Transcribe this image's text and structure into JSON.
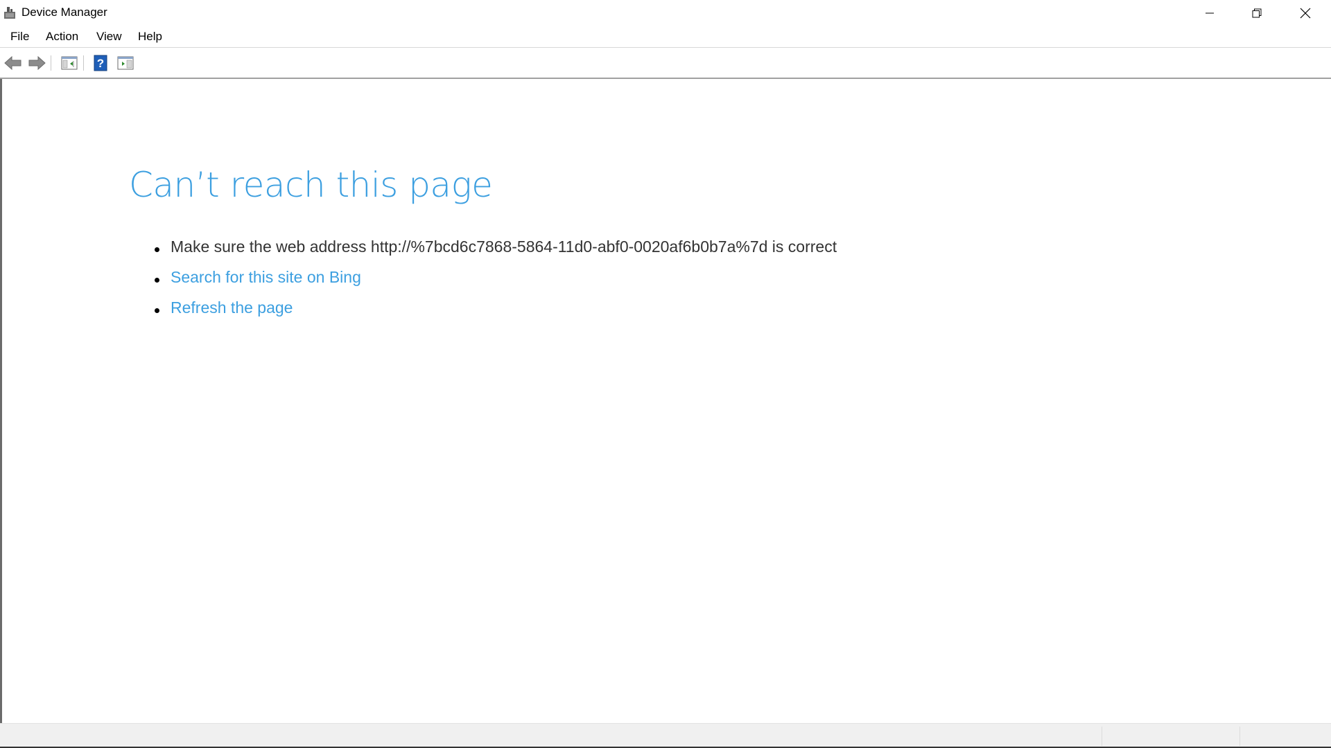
{
  "window": {
    "title": "Device Manager"
  },
  "menu": {
    "file": "File",
    "action": "Action",
    "view": "View",
    "help": "Help"
  },
  "toolbar": {
    "icons": [
      "back-arrow-icon",
      "forward-arrow-icon",
      "show-hide-console-tree-icon",
      "help-icon",
      "show-hide-action-pane-icon"
    ]
  },
  "error_page": {
    "title": "Can’t reach this page",
    "items": [
      {
        "text": "Make sure the web address http://%7bcd6c7868-5864-11d0-abf0-0020af6b0b7a%7d is correct",
        "link": false
      },
      {
        "text": "Search for this site on Bing",
        "link": true
      },
      {
        "text": "Refresh the page",
        "link": true
      }
    ]
  },
  "colors": {
    "accent": "#3c9fe0",
    "text": "#333333",
    "statusbar": "#f0f0f0"
  }
}
